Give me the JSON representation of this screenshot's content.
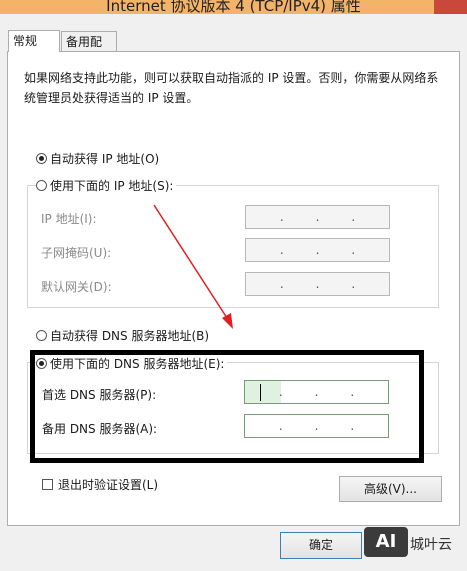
{
  "window": {
    "title": "Internet 协议版本 4 (TCP/IPv4) 属性"
  },
  "tabs": [
    {
      "label": "常规",
      "active": true
    },
    {
      "label": "备用配置",
      "active": false
    }
  ],
  "description": "如果网络支持此功能，则可以获取自动指派的 IP 设置。否则，你需要从网络系统管理员处获得适当的 IP 设置。",
  "ip": {
    "auto_label": "自动获得 IP 地址(O)",
    "manual_label": "使用下面的 IP 地址(S):",
    "fields": [
      {
        "label": "IP 地址(I):",
        "value": "."
      },
      {
        "label": "子网掩码(U):",
        "value": "."
      },
      {
        "label": "默认网关(D):",
        "value": "."
      }
    ]
  },
  "dns": {
    "auto_label": "自动获得 DNS 服务器地址(B)",
    "manual_label": "使用下面的 DNS 服务器地址(E):",
    "fields": [
      {
        "label": "首选 DNS 服务器(P):"
      },
      {
        "label": "备用 DNS 服务器(A):"
      }
    ]
  },
  "validate_label": "退出时验证设置(L)",
  "advanced_button": "高级(V)...",
  "ok_button": "确定",
  "watermark": {
    "logo": "AI",
    "text": "城叶云"
  },
  "colors": {
    "annotation_arrow": "#e02020",
    "title_bar": "#f3b46a"
  }
}
